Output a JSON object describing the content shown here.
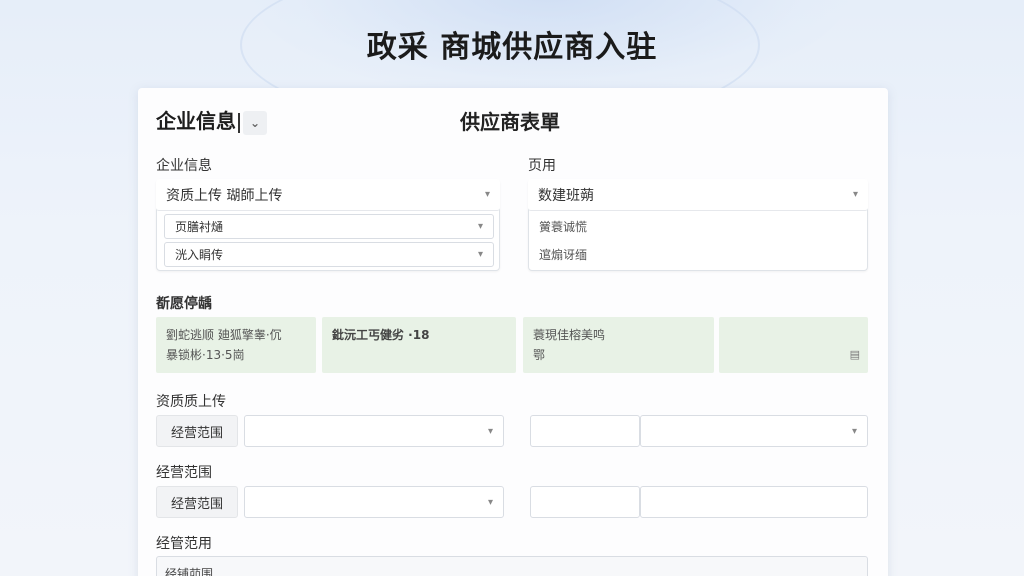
{
  "page": {
    "title": "政采 商城供应商入驻"
  },
  "header": {
    "company_info_title": "企业信息",
    "form_title": "供应商表單"
  },
  "left_group": {
    "label": "企业信息",
    "select_main": "资质上传 瑚師上传",
    "select_2": "页膳衬熥",
    "select_3": "洸入睊传"
  },
  "right_group": {
    "label": "页用",
    "select_main": "数建班蒴",
    "row_1": "黉蓑诚慌",
    "row_2": "逭煽讶缅"
  },
  "notices": {
    "label": "斱愿停龋",
    "box1_line1": "劉蛇逃顺 廸狐擎睾·伔",
    "box1_line2": "暴锁彬·13·5崗",
    "box2_line1": "鈚沅工丐健劣 ·18",
    "box3_line1": "蓑現佳榕美鸣",
    "box3_line2": "鄂",
    "box4_icon": "doc-icon"
  },
  "section1": {
    "label": "资质质上传",
    "tag": "经营范围"
  },
  "section2": {
    "label": "经营范围",
    "tag": "经营范围"
  },
  "section3": {
    "label": "经管范用",
    "field_value": "经铺茆围"
  },
  "icons": {
    "caret": "▾",
    "chevron": "⌄",
    "doc": "▤"
  }
}
